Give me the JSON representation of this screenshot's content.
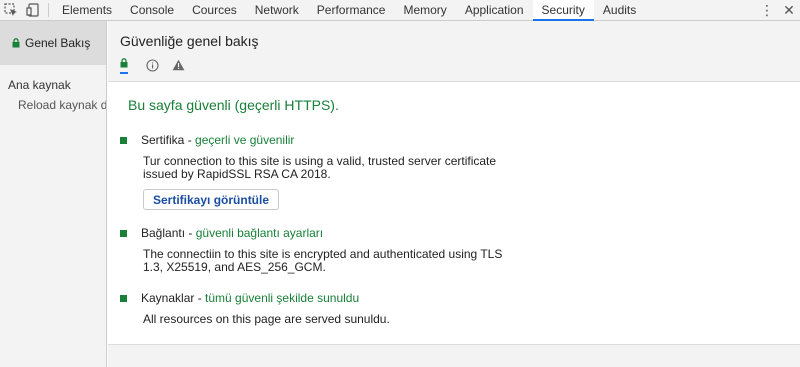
{
  "toolbar": {
    "tabs": [
      {
        "label": "Elements"
      },
      {
        "label": "Console"
      },
      {
        "label": "Cources"
      },
      {
        "label": "Network"
      },
      {
        "label": "Performance"
      },
      {
        "label": "Memory"
      },
      {
        "label": "Application"
      },
      {
        "label": "Security",
        "active": true
      },
      {
        "label": "Audits"
      }
    ],
    "inspect_icon": "cursor-select-icon",
    "device_icon": "device-toggle-icon",
    "more_icon": "vertical-dots-icon",
    "close_icon": "close-icon"
  },
  "sidebar": {
    "overview_label": "Genel Bakış",
    "origins_heading": "Ana kaynak",
    "reload_item": "Reload kaynak detai"
  },
  "main": {
    "title": "Güvenliğe genel bakış",
    "summary": "Bu sayfa güvenli (geçerli HTTPS).",
    "sections": [
      {
        "title": "Sertifika",
        "status": "geçerli ve güvenilir",
        "description": "Tur connection to this site is using a valid, trusted server certificate issued by RapidSSL RSA CA 2018.",
        "button": "Sertifikayı görüntüle"
      },
      {
        "title": "Bağlantı",
        "status": "güvenli bağlantı ayarları",
        "description": "The connectiin to this site is encrypted and authenticated using TLS 1.3, X25519, and AES_256_GCM."
      },
      {
        "title": "Kaynaklar",
        "status": "tümü güvenli şekilde sunuldu",
        "description": "All resources on this page are served sunuldu."
      }
    ]
  },
  "colors": {
    "secure_green": "#188038",
    "accent_blue": "#1a73e8",
    "button_text": "#1a4ea0"
  }
}
